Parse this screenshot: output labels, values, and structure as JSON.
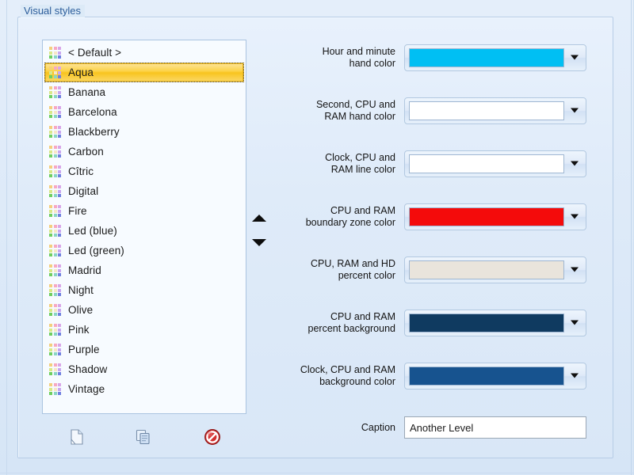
{
  "window": {
    "group_caption": "Visual styles"
  },
  "styles_list": {
    "name": "visual-styles-list",
    "selected": "Aqua",
    "items": [
      {
        "label": "< Default >",
        "selected": false
      },
      {
        "label": "Aqua",
        "selected": true
      },
      {
        "label": "Banana",
        "selected": false
      },
      {
        "label": "Barcelona",
        "selected": false
      },
      {
        "label": "Blackberry",
        "selected": false
      },
      {
        "label": "Carbon",
        "selected": false
      },
      {
        "label": "Cîtric",
        "selected": false
      },
      {
        "label": "Digital",
        "selected": false
      },
      {
        "label": "Fire",
        "selected": false
      },
      {
        "label": "Led (blue)",
        "selected": false
      },
      {
        "label": "Led (green)",
        "selected": false
      },
      {
        "label": "Madrid",
        "selected": false
      },
      {
        "label": "Night",
        "selected": false
      },
      {
        "label": "Olive",
        "selected": false
      },
      {
        "label": "Pink",
        "selected": false
      },
      {
        "label": "Purple",
        "selected": false
      },
      {
        "label": "Shadow",
        "selected": false
      },
      {
        "label": "Vintage",
        "selected": false
      }
    ],
    "item_icon": "palette-icon",
    "palette_swatch_colors": [
      "#f4cf7e",
      "#f7a9c2",
      "#d9a6e8",
      "#d9e88a",
      "#f7e7c6",
      "#c9a6f0",
      "#6fcf5f",
      "#8ad6c4",
      "#6f7fe0"
    ]
  },
  "reorder": {
    "up_icon": "triangle-up-icon",
    "down_icon": "triangle-down-icon"
  },
  "fields": [
    {
      "label": "Hour and minute\nhand color",
      "name": "hour-minute-hand-color",
      "color": "#00BFF3",
      "arrow_icon": "chevron-down-icon"
    },
    {
      "label": "Second, CPU and\nRAM hand color",
      "name": "second-cpu-ram-hand-color",
      "color": "#FFFFFF",
      "arrow_icon": "chevron-down-icon"
    },
    {
      "label": "Clock, CPU and\nRAM line color",
      "name": "clock-cpu-ram-line-color",
      "color": "#FFFFFF",
      "arrow_icon": "chevron-down-icon"
    },
    {
      "label": "CPU and RAM\nboundary zone color",
      "name": "cpu-ram-boundary-zone-color",
      "color": "#F40B0B",
      "arrow_icon": "chevron-down-icon"
    },
    {
      "label": "CPU, RAM and HD\npercent color",
      "name": "cpu-ram-hd-percent-color",
      "color": "#E9E4DC",
      "arrow_icon": "chevron-down-icon"
    },
    {
      "label": "CPU and RAM\npercent background",
      "name": "cpu-ram-percent-background",
      "color": "#0F3A60",
      "arrow_icon": "chevron-down-icon"
    },
    {
      "label": "Clock, CPU and RAM\nbackground color",
      "name": "clock-cpu-ram-background-color",
      "color": "#17538F",
      "arrow_icon": "chevron-down-icon"
    }
  ],
  "caption_field": {
    "label": "Caption",
    "value": "Another Level",
    "placeholder": ""
  },
  "toolbar": {
    "new_icon": "new-document-icon",
    "copy_icon": "copy-duplicate-icon",
    "delete_icon": "delete-prohibited-icon",
    "delete_color": "#CC2222"
  }
}
